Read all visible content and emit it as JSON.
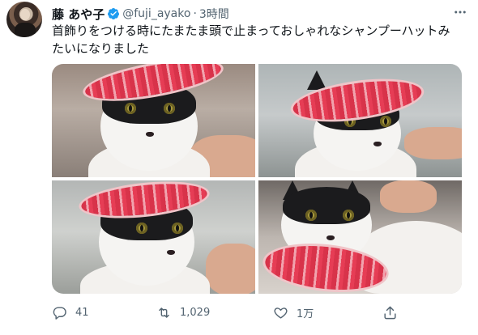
{
  "author": {
    "name": "藤 あや子",
    "handle": "@fuji_ayako",
    "separator": "·",
    "time": "3時間"
  },
  "tweet": {
    "line1": "首飾りをつける時にたまたま頭で止まっておしゃれなシャンプーハットみ",
    "line2": "たいになりました"
  },
  "actions": {
    "reply_count": "41",
    "retweet_count": "1,029",
    "like_count": "1万"
  },
  "colors": {
    "verified": "#1d9bf0",
    "muted": "#536471",
    "text": "#0f1419"
  },
  "icons": {
    "verified": "verified-badge-icon",
    "more": "more-icon",
    "reply": "reply-icon",
    "retweet": "retweet-icon",
    "like": "heart-icon",
    "share": "share-icon"
  }
}
